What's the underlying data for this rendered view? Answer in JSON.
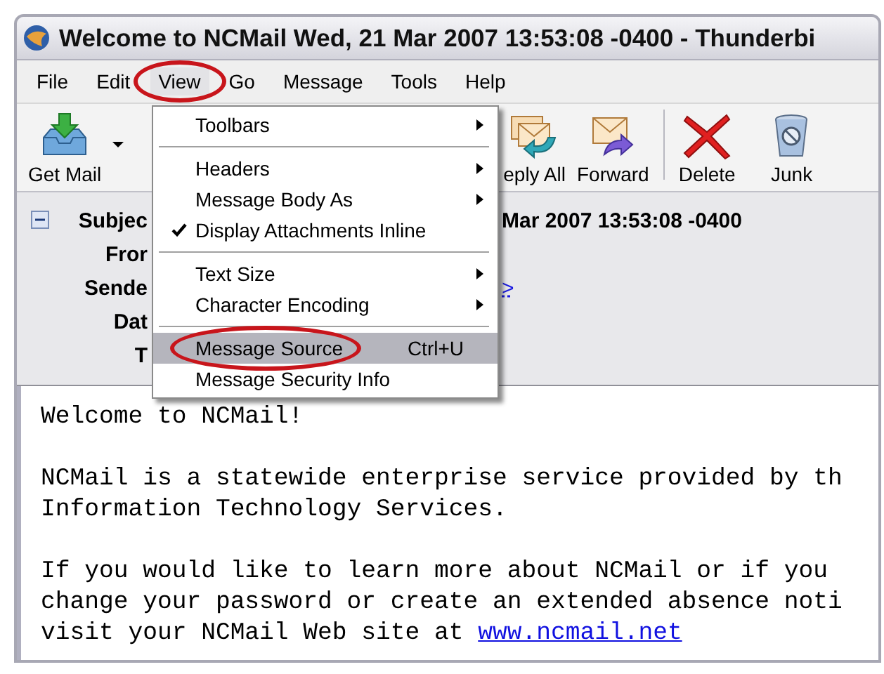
{
  "window": {
    "title": "Welcome to NCMail Wed, 21 Mar 2007 13:53:08 -0400 - Thunderbi"
  },
  "menu_bar": [
    {
      "label": "File",
      "selected": false,
      "circled": false
    },
    {
      "label": "Edit",
      "selected": false,
      "circled": false
    },
    {
      "label": "View",
      "selected": true,
      "circled": true
    },
    {
      "label": "Go",
      "selected": false,
      "circled": false
    },
    {
      "label": "Message",
      "selected": false,
      "circled": false
    },
    {
      "label": "Tools",
      "selected": false,
      "circled": false
    },
    {
      "label": "Help",
      "selected": false,
      "circled": false
    }
  ],
  "toolbar": [
    {
      "kind": "get-mail",
      "label": "Get Mail",
      "dropdown": true
    },
    {
      "kind": "reply-all",
      "label": "eply All",
      "dropdown": false
    },
    {
      "kind": "forward",
      "label": "Forward",
      "dropdown": false
    },
    {
      "kind": "delete",
      "label": "Delete",
      "dropdown": false
    },
    {
      "kind": "junk",
      "label": "Junk",
      "dropdown": false
    }
  ],
  "message_header": {
    "expanded": true,
    "fields": [
      {
        "label": "Subjec",
        "kind": "text",
        "value": "Mar 2007 13:53:08 -0400"
      },
      {
        "label": "Fror",
        "kind": "text"
      },
      {
        "label": "Sende",
        "kind": "link",
        "value": ">"
      },
      {
        "label": "Dat",
        "kind": "text"
      },
      {
        "label": "T",
        "kind": "text"
      }
    ]
  },
  "message_body": {
    "paragraphs": [
      [
        {
          "text": "Welcome to NCMail!"
        }
      ],
      [
        {
          "text": "NCMail is a statewide enterprise service provided by th"
        },
        {
          "text": "Information Technology Services."
        }
      ],
      [
        {
          "text": "If you would like to learn more about NCMail or if you"
        },
        {
          "text": "change your password or create an extended absence noti"
        },
        {
          "text": "visit your NCMail Web site at ",
          "link": "www.ncmail.net"
        }
      ]
    ]
  },
  "view_menu": {
    "items": [
      {
        "kind": "item",
        "label": "Toolbars",
        "submenu": true,
        "checked": false,
        "selected": false,
        "circled": false
      },
      {
        "kind": "separator"
      },
      {
        "kind": "item",
        "label": "Headers",
        "submenu": true,
        "checked": false,
        "selected": false,
        "circled": false
      },
      {
        "kind": "item",
        "label": "Message Body As",
        "submenu": true,
        "checked": false,
        "selected": false,
        "circled": false
      },
      {
        "kind": "item",
        "label": "Display Attachments Inline",
        "submenu": false,
        "checked": true,
        "selected": false,
        "circled": false
      },
      {
        "kind": "separator"
      },
      {
        "kind": "item",
        "label": "Text Size",
        "submenu": true,
        "checked": false,
        "selected": false,
        "circled": false
      },
      {
        "kind": "item",
        "label": "Character Encoding",
        "submenu": true,
        "checked": false,
        "selected": false,
        "circled": false
      },
      {
        "kind": "separator"
      },
      {
        "kind": "item",
        "label": "Message Source",
        "shortcut": "Ctrl+U",
        "submenu": false,
        "checked": false,
        "selected": true,
        "circled": true
      },
      {
        "kind": "item",
        "label": "Message Security Info",
        "submenu": false,
        "checked": false,
        "selected": false,
        "circled": false
      }
    ]
  }
}
